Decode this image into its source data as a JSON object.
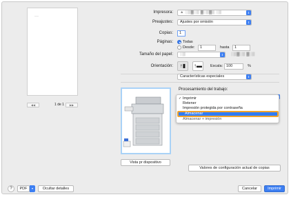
{
  "preview": {
    "page_tiny_text": "——",
    "page_count": "1 de 1",
    "prev_btn": "◀◀",
    "next_btn": "▶▶"
  },
  "form": {
    "printer_label": "Impresora:",
    "printer_value": "▲ ░▒▓░▒ ▓░▒▓▒ ░▒",
    "presets_label": "Preajustes:",
    "presets_value": "Ajustes por omisión",
    "copies_label": "Copias:",
    "copies_value": "1",
    "pages_label": "Páginas:",
    "pages_all": "Todas",
    "pages_from": "Desde:",
    "pages_from_value": "1",
    "pages_to": "hasta",
    "pages_to_value": "1",
    "paper_label": "Tamaño del papel:",
    "paper_value": "░▒",
    "paper_dims": "░▒▓░▒ ▓░▒",
    "orientation_label": "Orientación:",
    "scale_label": "Escala:",
    "scale_value": "100",
    "scale_unit": "%",
    "section_value": "Características especiales"
  },
  "processing": {
    "title": "Procesamiento del trabajo:",
    "items": [
      {
        "label": "Imprimir",
        "checked": true
      },
      {
        "label": "Retener",
        "checked": false
      },
      {
        "label": "Impresión protegida por contraseña",
        "checked": false
      },
      {
        "label": "Almacenar",
        "checked": false,
        "selected": true
      },
      {
        "label": "Almacenar + impresión",
        "checked": false
      }
    ]
  },
  "buttons": {
    "device_view": "Vista pr dispositivo",
    "current_config": "Valores de configuración actual de copias",
    "pdf": "PDF",
    "hide_details": "Ocultar detalles",
    "cancel": "Cancelar",
    "print": "Imprimir",
    "help": "?"
  },
  "colors": {
    "accent": "#3d7ff2",
    "highlight_border": "#f4a52c",
    "image_frame": "#a9d2f7"
  },
  "icons": {
    "orientation_portrait": "portrait-icon",
    "orientation_landscape": "landscape-icon"
  }
}
